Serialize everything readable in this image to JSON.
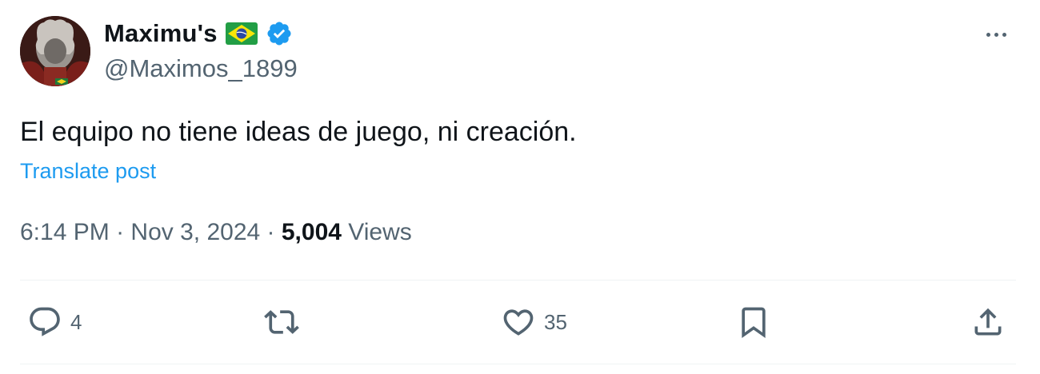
{
  "author": {
    "display_name": "Maximu's",
    "handle": "@Maximos_1899",
    "flag_icon": "brazil-flag-icon",
    "verified_icon": "verified-badge-icon",
    "verified_color": "#1d9bf0"
  },
  "tweet": {
    "text": "El equipo no tiene ideas de juego, ni creación.",
    "translate_label": "Translate post",
    "time": "6:14 PM",
    "separator": " · ",
    "date": "Nov 3, 2024",
    "views_count": "5,004",
    "views_label": " Views"
  },
  "actions": {
    "replies": "4",
    "reposts": "",
    "likes": "35"
  },
  "colors": {
    "text_primary": "#0f1419",
    "text_secondary": "#536471",
    "link": "#1d9bf0",
    "divider": "#eff3f4"
  }
}
